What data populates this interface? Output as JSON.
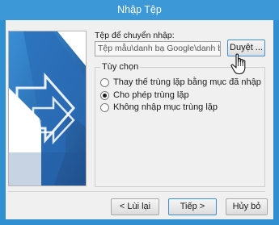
{
  "window": {
    "title": "Nhập Tệp"
  },
  "file": {
    "label": "Tệp để chuyển nhập:",
    "path": "Tệp mẫu\\danh bạ Google\\danh bạ.csv",
    "browse_label": "Duyệt ..."
  },
  "options": {
    "title": "Tùy chọn",
    "items": [
      {
        "label": "Thay thế trùng lặp bằng mục đã nhập",
        "checked": false
      },
      {
        "label": "Cho phép trùng lặp",
        "checked": true
      },
      {
        "label": "Không nhập mục trùng lặp",
        "checked": false
      }
    ]
  },
  "buttons": {
    "back_label": "< Lùi lại",
    "next_label": "Tiếp >",
    "cancel_label": "Hủy bỏ"
  },
  "colors": {
    "titlebar": "#3c98d6",
    "illustration_blue": "#2f7fc1",
    "illustration_dark": "#1f4e8c"
  }
}
